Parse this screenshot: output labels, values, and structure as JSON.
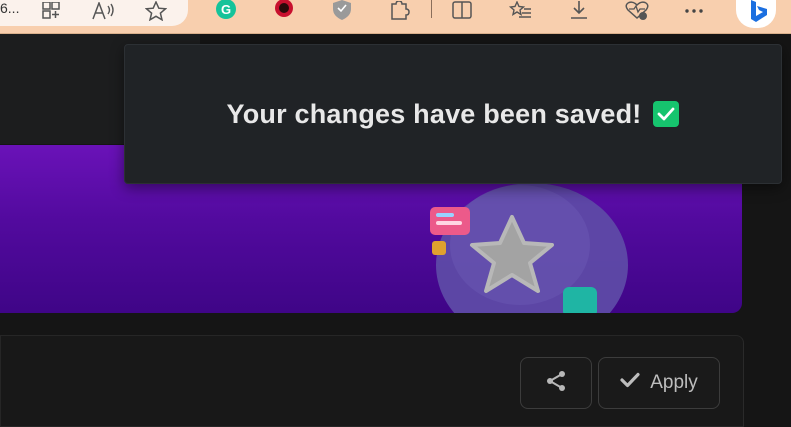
{
  "browser": {
    "address_text": "6...",
    "toolbar_icons": [
      "grid-icon",
      "read-aloud-icon",
      "favorite-star-icon",
      "grammarly-icon",
      "extension-red-icon",
      "shield-extension-icon",
      "extensions-puzzle-icon",
      "split-screen-icon",
      "favorites-list-icon",
      "download-icon",
      "performance-icon",
      "more-icon",
      "bing-icon"
    ]
  },
  "toast": {
    "message": "Your changes have been saved!",
    "icon": "check-mark-button-icon",
    "icon_color": "#16c46e"
  },
  "banner": {
    "gradient_top": "#6a12b8",
    "gradient_bottom": "#3f0587",
    "illustration": "star-bubble-illustration"
  },
  "actions": {
    "share_icon": "share-icon",
    "apply_label": "Apply",
    "apply_icon": "check-icon"
  }
}
